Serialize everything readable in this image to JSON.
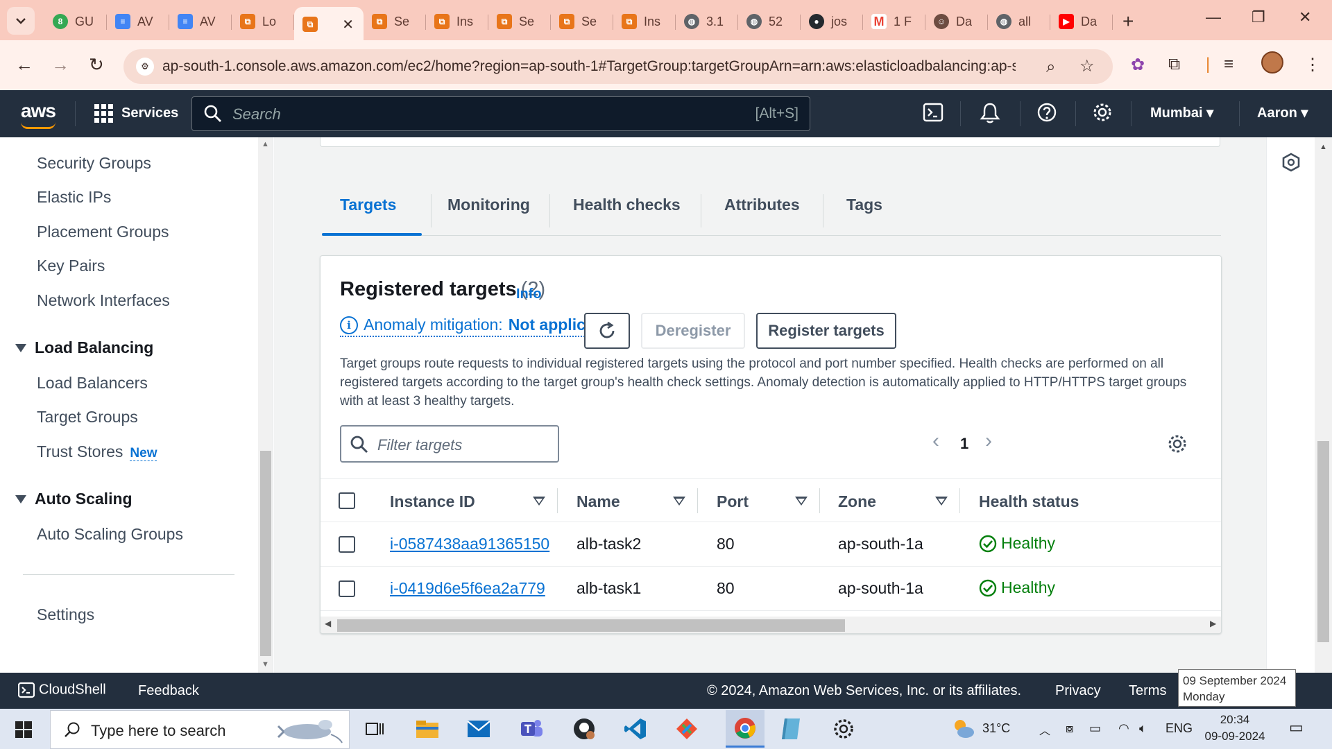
{
  "browser": {
    "tabs": [
      {
        "label": "GU",
        "icon": "green-8-icon",
        "color": "#34a853"
      },
      {
        "label": "AV",
        "icon": "docs-icon",
        "color": "#4285f4"
      },
      {
        "label": "AV",
        "icon": "docs-icon",
        "color": "#4285f4"
      },
      {
        "label": "Lo",
        "icon": "aws-cube-icon",
        "color": "#e8751a"
      },
      {
        "label": "",
        "icon": "aws-cube-icon",
        "color": "#e8751a",
        "active": true
      },
      {
        "label": "Se",
        "icon": "aws-cube-icon",
        "color": "#e8751a"
      },
      {
        "label": "Ins",
        "icon": "aws-cube-icon",
        "color": "#e8751a"
      },
      {
        "label": "Se",
        "icon": "aws-cube-icon",
        "color": "#e8751a"
      },
      {
        "label": "Se",
        "icon": "aws-cube-icon",
        "color": "#e8751a"
      },
      {
        "label": "Ins",
        "icon": "aws-cube-icon",
        "color": "#e8751a"
      },
      {
        "label": "3.1",
        "icon": "globe-icon",
        "color": "#5f6368"
      },
      {
        "label": "52",
        "icon": "globe-icon",
        "color": "#5f6368"
      },
      {
        "label": "jos",
        "icon": "github-icon",
        "color": "#24292e"
      },
      {
        "label": "1 F",
        "icon": "gmail-icon",
        "color": "#ea4335"
      },
      {
        "label": "Da",
        "icon": "person-icon",
        "color": "#6d4c41"
      },
      {
        "label": "all",
        "icon": "globe-icon",
        "color": "#5f6368"
      },
      {
        "label": "Da",
        "icon": "youtube-icon",
        "color": "#ff0000"
      }
    ],
    "url": "ap-south-1.console.aws.amazon.com/ec2/home?region=ap-south-1#TargetGroup:targetGroupArn=arn:aws:elasticloadbalancing:ap-s..."
  },
  "aws_nav": {
    "logo": "aws",
    "services": "Services",
    "search_placeholder": "Search",
    "search_shortcut": "[Alt+S]",
    "region": "Mumbai",
    "user": "Aaron"
  },
  "sidenav": {
    "items_top": [
      "Security Groups",
      "Elastic IPs",
      "Placement Groups",
      "Key Pairs",
      "Network Interfaces"
    ],
    "load_balancing": {
      "title": "Load Balancing",
      "items": [
        "Load Balancers",
        "Target Groups",
        "Trust Stores"
      ],
      "new_badge": "New"
    },
    "auto_scaling": {
      "title": "Auto Scaling",
      "items": [
        "Auto Scaling Groups"
      ]
    },
    "settings": "Settings"
  },
  "page_tabs": [
    "Targets",
    "Monitoring",
    "Health checks",
    "Attributes",
    "Tags"
  ],
  "registered_targets": {
    "title": "Registered targets",
    "count": "(2)",
    "info": "Info",
    "anomaly_label": "Anomaly mitigation:",
    "anomaly_value": "Not applicable",
    "deregister": "Deregister",
    "register": "Register targets",
    "description": "Target groups route requests to individual registered targets using the protocol and port number specified. Health checks are performed on all registered targets according to the target group's health check settings. Anomaly detection is automatically applied to HTTP/HTTPS target groups with at least 3 healthy targets.",
    "filter_placeholder": "Filter targets",
    "page": "1",
    "columns": [
      "Instance ID",
      "Name",
      "Port",
      "Zone",
      "Health status"
    ],
    "rows": [
      {
        "instance_id": "i-0587438aa91365150",
        "name": "alb-task2",
        "port": "80",
        "zone": "ap-south-1a",
        "health": "Healthy"
      },
      {
        "instance_id": "i-0419d6e5f6ea2a779",
        "name": "alb-task1",
        "port": "80",
        "zone": "ap-south-1a",
        "health": "Healthy"
      }
    ]
  },
  "footer": {
    "cloudshell": "CloudShell",
    "feedback": "Feedback",
    "copyright": "© 2024, Amazon Web Services, Inc. or its affiliates.",
    "privacy": "Privacy",
    "terms": "Terms"
  },
  "tooltip": {
    "date": "09 September 2024",
    "day": "Monday"
  },
  "taskbar": {
    "search_placeholder": "Type here to search",
    "temperature": "31°C",
    "language": "ENG",
    "time": "20:34",
    "date": "09-09-2024"
  },
  "colors": {
    "aws_nav": "#232f3e",
    "link": "#0972d3",
    "healthy": "#037f0c",
    "browser_frame": "#f9cbbf"
  }
}
